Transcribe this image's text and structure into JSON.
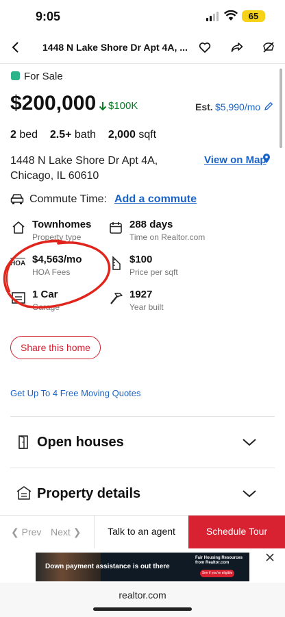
{
  "status_bar": {
    "time": "9:05",
    "battery": "65"
  },
  "header": {
    "title": "1448 N Lake Shore Dr Apt 4A, ...",
    "icons": [
      "back-arrow-icon",
      "heart-icon",
      "share-icon",
      "hide-icon"
    ]
  },
  "listing": {
    "status": "For Sale",
    "status_color": "#2bb38a",
    "price": "$200,000",
    "price_drop": "$100K",
    "est_label": "Est.",
    "est_value": "$5,990/mo",
    "beds_value": "2",
    "beds_label": "bed",
    "baths_value": "2.5+",
    "baths_label": "bath",
    "sqft_value": "2,000",
    "sqft_label": "sqft",
    "address": "1448 N Lake Shore Dr Apt 4A, Chicago, IL 60610",
    "view_map": "View on Map"
  },
  "commute": {
    "label": "Commute Time:",
    "link": "Add a commute"
  },
  "features": [
    {
      "value": "Townhomes",
      "label": "Property type",
      "icon": "house-icon"
    },
    {
      "value": "288 days",
      "label": "Time on Realtor.com",
      "icon": "calendar-icon"
    },
    {
      "value": "$4,563/mo",
      "label": "HOA Fees",
      "icon": "hoa-icon"
    },
    {
      "value": "$100",
      "label": "Price per sqft",
      "icon": "ruler-icon"
    },
    {
      "value": "1 Car",
      "label": "Garage",
      "icon": "garage-icon"
    },
    {
      "value": "1927",
      "label": "Year built",
      "icon": "hammer-icon"
    }
  ],
  "share_button": "Share this home",
  "moving_link": "Get Up To 4 Free Moving Quotes",
  "sections": [
    {
      "title": "Open houses",
      "icon": "door-icon"
    },
    {
      "title": "Property details",
      "icon": "house-list-icon"
    }
  ],
  "bottom_bar": {
    "prev": "Prev",
    "next": "Next",
    "talk": "Talk to an agent",
    "tour": "Schedule Tour"
  },
  "ad": {
    "text": "Down payment assistance is out there",
    "brand": "Fair Housing Resources from Realtor.com",
    "cta": "See if you're eligible"
  },
  "browser": {
    "url": "realtor.com"
  },
  "colors": {
    "accent_red": "#d92231",
    "link_blue": "#1a63c7",
    "drop_green": "#0a7d25"
  }
}
